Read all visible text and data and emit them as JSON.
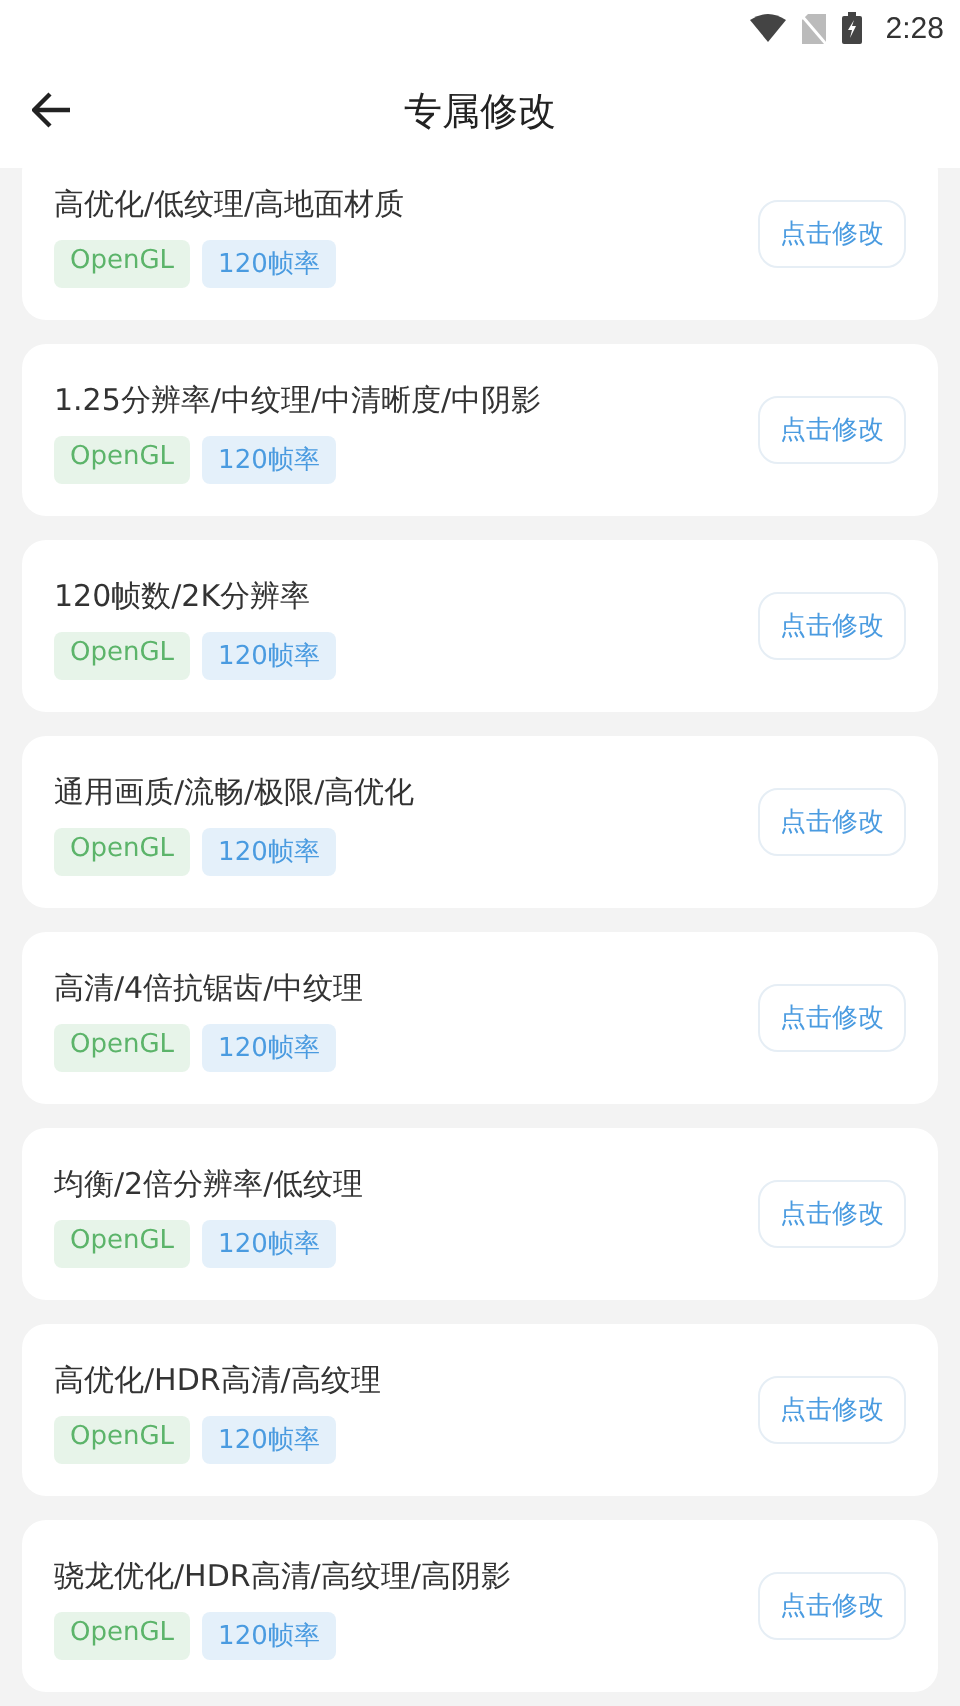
{
  "status_bar": {
    "time": "2:28"
  },
  "header": {
    "title": "专属修改"
  },
  "items": [
    {
      "title": "高优化/低纹理/高地面材质",
      "tags": [
        {
          "label": "OpenGL",
          "color": "#5cb46a"
        },
        {
          "label": "120帧率",
          "color": "#4a9be0"
        }
      ],
      "button": "点击修改"
    },
    {
      "title": "1.25分辨率/中纹理/中清晰度/中阴影",
      "tags": [
        {
          "label": "OpenGL",
          "color": "#5cb46a"
        },
        {
          "label": "120帧率",
          "color": "#4a9be0"
        }
      ],
      "button": "点击修改"
    },
    {
      "title": "120帧数/2K分辨率",
      "tags": [
        {
          "label": "OpenGL",
          "color": "#5cb46a"
        },
        {
          "label": "120帧率",
          "color": "#4a9be0"
        }
      ],
      "button": "点击修改"
    },
    {
      "title": "通用画质/流畅/极限/高优化",
      "tags": [
        {
          "label": "OpenGL",
          "color": "#5cb46a"
        },
        {
          "label": "120帧率",
          "color": "#4a9be0"
        }
      ],
      "button": "点击修改"
    },
    {
      "title": "高清/4倍抗锯齿/中纹理",
      "tags": [
        {
          "label": "OpenGL",
          "color": "#5cb46a"
        },
        {
          "label": "120帧率",
          "color": "#4a9be0"
        }
      ],
      "button": "点击修改"
    },
    {
      "title": "均衡/2倍分辨率/低纹理",
      "tags": [
        {
          "label": "OpenGL",
          "color": "#5cb46a"
        },
        {
          "label": "120帧率",
          "color": "#4a9be0"
        }
      ],
      "button": "点击修改"
    },
    {
      "title": "高优化/HDR高清/高纹理",
      "tags": [
        {
          "label": "OpenGL",
          "color": "#5cb46a"
        },
        {
          "label": "120帧率",
          "color": "#4a9be0"
        }
      ],
      "button": "点击修改"
    },
    {
      "title": "骁龙优化/HDR高清/高纹理/高阴影",
      "tags": [
        {
          "label": "OpenGL",
          "color": "#5cb46a"
        },
        {
          "label": "120帧率",
          "color": "#4a9be0"
        }
      ],
      "button": "点击修改"
    }
  ]
}
